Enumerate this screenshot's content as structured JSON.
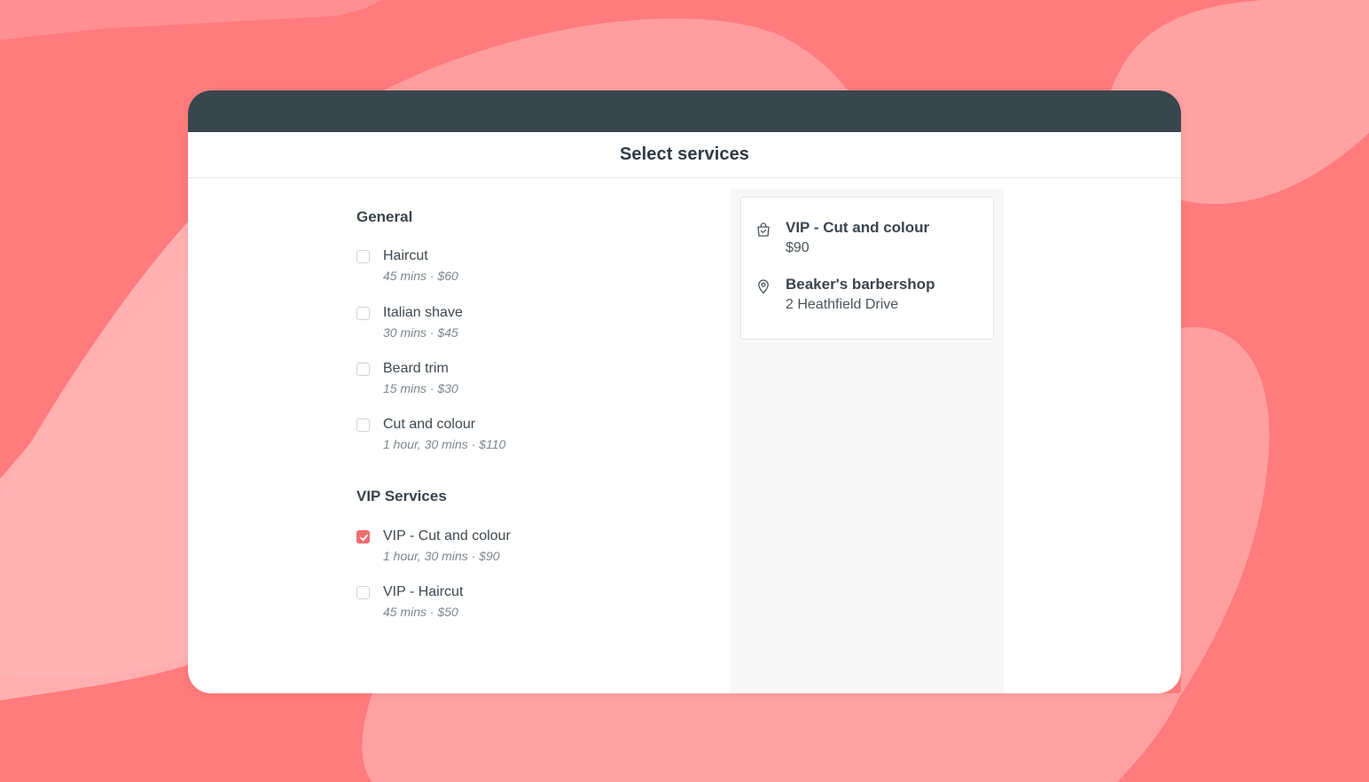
{
  "colors": {
    "background": "#ff7b7d",
    "accent": "#f26c72",
    "topbar": "#3a464e"
  },
  "header": {
    "title": "Select services"
  },
  "sections": [
    {
      "title": "General",
      "services": [
        {
          "name": "Haircut",
          "meta": "45 mins · $60",
          "checked": false
        },
        {
          "name": "Italian shave",
          "meta": "30 mins · $45",
          "checked": false
        },
        {
          "name": "Beard trim",
          "meta": "15 mins · $30",
          "checked": false
        },
        {
          "name": "Cut and colour",
          "meta": "1 hour, 30 mins · $110",
          "checked": false
        }
      ]
    },
    {
      "title": "VIP Services",
      "services": [
        {
          "name": "VIP - Cut and colour",
          "meta": "1 hour, 30 mins · $90",
          "checked": true
        },
        {
          "name": "VIP - Haircut",
          "meta": "45 mins · $50",
          "checked": false
        }
      ]
    }
  ],
  "summary": {
    "service": {
      "icon": "shopping-bag-icon",
      "title": "VIP - Cut and colour",
      "price": "$90"
    },
    "location": {
      "icon": "map-pin-icon",
      "name": "Beaker's barbershop",
      "address": "2 Heathfield Drive"
    }
  }
}
